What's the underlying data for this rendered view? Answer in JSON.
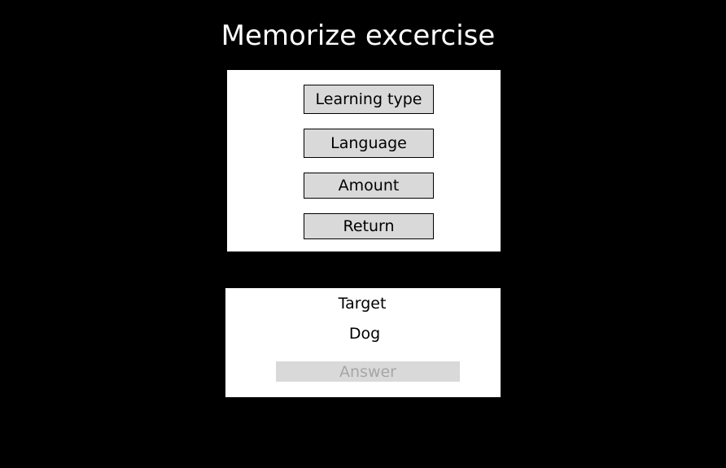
{
  "page": {
    "title": "Memorize excercise"
  },
  "menu": {
    "learning_type_label": "Learning type",
    "language_label": "Language",
    "amount_label": "Amount",
    "return_label": "Return"
  },
  "exercise": {
    "target_label": "Target",
    "target_word": "Dog",
    "answer_placeholder": "Answer",
    "answer_value": ""
  },
  "colors": {
    "background": "#000000",
    "panel": "#ffffff",
    "button_fill": "#d9d9d9",
    "placeholder_text": "#a6a6a6"
  }
}
